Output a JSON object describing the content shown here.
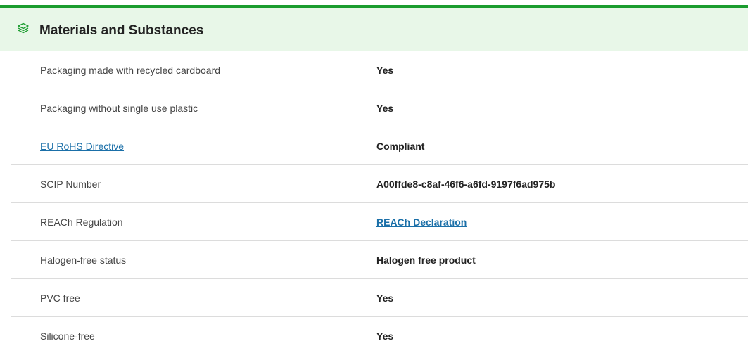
{
  "section": {
    "title": "Materials and Substances",
    "icon": "layers-icon",
    "accent_color": "#1a9c2e",
    "header_bg": "#e8f7e8",
    "link_color": "#1a6fa8"
  },
  "rows": [
    {
      "label": "Packaging made with recycled cardboard",
      "value": "Yes"
    },
    {
      "label": "Packaging without single use plastic",
      "value": "Yes"
    },
    {
      "label": "EU RoHS Directive",
      "value": "Compliant"
    },
    {
      "label": "SCIP Number",
      "value": "A00ffde8-c8af-46f6-a6fd-9197f6ad975b"
    },
    {
      "label": "REACh Regulation",
      "value": "REACh Declaration"
    },
    {
      "label": "Halogen-free status",
      "value": "Halogen free product"
    },
    {
      "label": "PVC free",
      "value": "Yes"
    },
    {
      "label": "Silicone-free",
      "value": "Yes"
    }
  ]
}
